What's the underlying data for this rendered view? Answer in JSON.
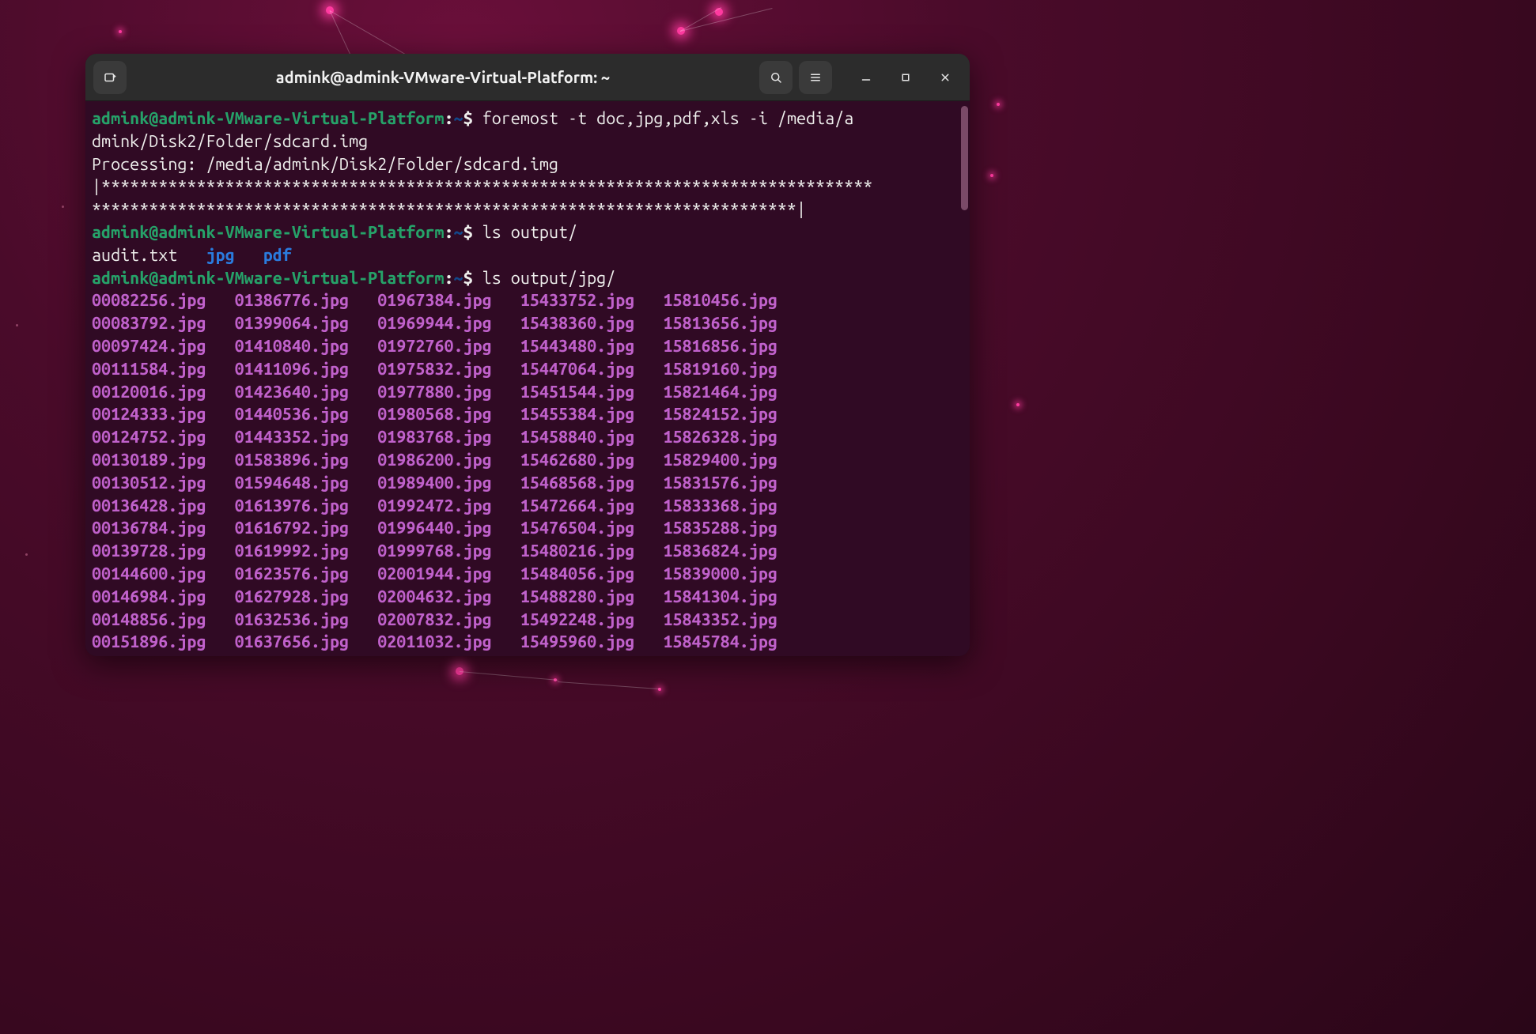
{
  "window_title": "admink@admink-VMware-Virtual-Platform: ~",
  "prompt": {
    "userhost": "admink@admink-VMware-Virtual-Platform",
    "colon": ":",
    "path": "~",
    "dollar": "$"
  },
  "cmd1": "foremost -t doc,jpg,pdf,xls -i /media/a",
  "cmd1_wrap": "dmink/Disk2/Folder/sdcard.img",
  "proc_line": "Processing: /media/admink/Disk2/Folder/sdcard.img",
  "stars1": "|*********************************************************************************",
  "stars2": "**************************************************************************|",
  "cmd2": "ls output/",
  "ls_output": {
    "audit": "audit.txt",
    "jpg": "jpg",
    "pdf": "pdf"
  },
  "cmd3": "ls output/jpg/",
  "jpg_columns": [
    [
      "00082256.jpg",
      "00083792.jpg",
      "00097424.jpg",
      "00111584.jpg",
      "00120016.jpg",
      "00124333.jpg",
      "00124752.jpg",
      "00130189.jpg",
      "00130512.jpg",
      "00136428.jpg",
      "00136784.jpg",
      "00139728.jpg",
      "00144600.jpg",
      "00146984.jpg",
      "00148856.jpg",
      "00151896.jpg"
    ],
    [
      "01386776.jpg",
      "01399064.jpg",
      "01410840.jpg",
      "01411096.jpg",
      "01423640.jpg",
      "01440536.jpg",
      "01443352.jpg",
      "01583896.jpg",
      "01594648.jpg",
      "01613976.jpg",
      "01616792.jpg",
      "01619992.jpg",
      "01623576.jpg",
      "01627928.jpg",
      "01632536.jpg",
      "01637656.jpg"
    ],
    [
      "01967384.jpg",
      "01969944.jpg",
      "01972760.jpg",
      "01975832.jpg",
      "01977880.jpg",
      "01980568.jpg",
      "01983768.jpg",
      "01986200.jpg",
      "01989400.jpg",
      "01992472.jpg",
      "01996440.jpg",
      "01999768.jpg",
      "02001944.jpg",
      "02004632.jpg",
      "02007832.jpg",
      "02011032.jpg"
    ],
    [
      "15433752.jpg",
      "15438360.jpg",
      "15443480.jpg",
      "15447064.jpg",
      "15451544.jpg",
      "15455384.jpg",
      "15458840.jpg",
      "15462680.jpg",
      "15468568.jpg",
      "15472664.jpg",
      "15476504.jpg",
      "15480216.jpg",
      "15484056.jpg",
      "15488280.jpg",
      "15492248.jpg",
      "15495960.jpg"
    ],
    [
      "15810456.jpg",
      "15813656.jpg",
      "15816856.jpg",
      "15819160.jpg",
      "15821464.jpg",
      "15824152.jpg",
      "15826328.jpg",
      "15829400.jpg",
      "15831576.jpg",
      "15833368.jpg",
      "15835288.jpg",
      "15836824.jpg",
      "15839000.jpg",
      "15841304.jpg",
      "15843352.jpg",
      "15845784.jpg"
    ]
  ]
}
